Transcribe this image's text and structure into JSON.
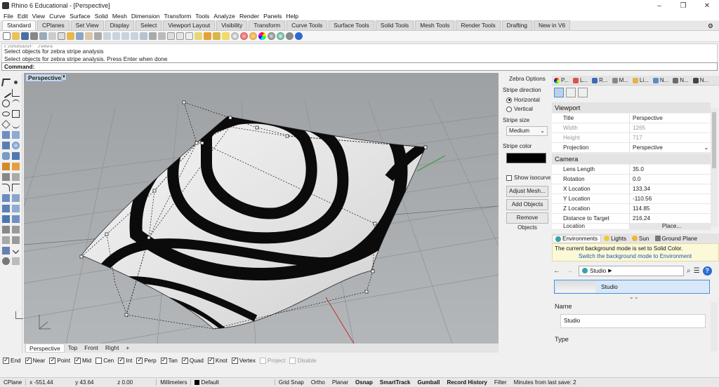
{
  "window": {
    "title": "Rhino 6 Educational - [Perspective]",
    "controls": [
      "–",
      "❐",
      "✕"
    ]
  },
  "menu": [
    "File",
    "Edit",
    "View",
    "Curve",
    "Surface",
    "Solid",
    "Mesh",
    "Dimension",
    "Transform",
    "Tools",
    "Analyze",
    "Render",
    "Panels",
    "Help"
  ],
  "toolbar_tabs": [
    "Standard",
    "CPlanes",
    "Set View",
    "Display",
    "Select",
    "Viewport Layout",
    "Visibility",
    "Transform",
    "Curve Tools",
    "Surface Tools",
    "Solid Tools",
    "Mesh Tools",
    "Render Tools",
    "Drafting",
    "New in V6"
  ],
  "toolbar_tabs_active": "Standard",
  "command_history": [
    "Command: _Zebra",
    "Select objects for zebra stripe analysis",
    "Select objects for zebra stripe analysis. Press Enter when done"
  ],
  "command_prompt": "Command:",
  "viewport": {
    "name": "Perspective",
    "tabs": [
      "Perspective",
      "Top",
      "Front",
      "Right"
    ],
    "add_tab": "+"
  },
  "zebra": {
    "title": "Zebra Options",
    "direction_label": "Stripe direction",
    "direction_options": [
      "Horizontal",
      "Vertical"
    ],
    "direction_selected": "Horizontal",
    "size_label": "Stripe size",
    "size_value": "Medium",
    "color_label": "Stripe color",
    "stripe_color": "#000000",
    "show_isocurves": "Show isocurves",
    "buttons": [
      "Adjust Mesh...",
      "Add Objects",
      "Remove Objects"
    ]
  },
  "properties": {
    "tabs": [
      "P...",
      "L...",
      "R...",
      "M...",
      "Li...",
      "N...",
      "N...",
      "N..."
    ],
    "sections": {
      "viewport": "Viewport",
      "camera": "Camera"
    },
    "viewport_rows": [
      {
        "key": "Title",
        "value": "Perspective",
        "dim": false
      },
      {
        "key": "Width",
        "value": "1265",
        "dim": true
      },
      {
        "key": "Height",
        "value": "717",
        "dim": true
      },
      {
        "key": "Projection",
        "value": "Perspective",
        "dim": false
      }
    ],
    "camera_rows": [
      {
        "key": "Lens Length",
        "value": "35.0"
      },
      {
        "key": "Rotation",
        "value": "0.0"
      },
      {
        "key": "X Location",
        "value": "133.34"
      },
      {
        "key": "Y Location",
        "value": "-110.56"
      },
      {
        "key": "Z Location",
        "value": "114.85"
      },
      {
        "key": "Distance to Target",
        "value": "216.24"
      },
      {
        "key": "Location",
        "value": "Place..."
      }
    ]
  },
  "environments": {
    "tabs": [
      "Environments",
      "Lights",
      "Sun",
      "Ground Plane"
    ],
    "note": "The current background mode is set to Solid Color.",
    "note_link": "Switch the background mode to Environment",
    "crumb": "Studio",
    "thumb_name": "Studio",
    "name_label": "Name",
    "name_value": "Studio",
    "type_label": "Type"
  },
  "osnaps": [
    {
      "label": "End",
      "on": true
    },
    {
      "label": "Near",
      "on": true
    },
    {
      "label": "Point",
      "on": true
    },
    {
      "label": "Mid",
      "on": true
    },
    {
      "label": "Cen",
      "on": false
    },
    {
      "label": "Int",
      "on": true
    },
    {
      "label": "Perp",
      "on": true
    },
    {
      "label": "Tan",
      "on": true
    },
    {
      "label": "Quad",
      "on": true
    },
    {
      "label": "Knot",
      "on": true
    },
    {
      "label": "Vertex",
      "on": true
    },
    {
      "label": "Project",
      "on": false,
      "disabled": true
    },
    {
      "label": "Disable",
      "on": false,
      "disabled": true
    }
  ],
  "status": {
    "cplane": "CPlane",
    "x": "x -551.44",
    "y": "y 43.64",
    "z": "z 0.00",
    "units": "Millimeters",
    "layer": "Default",
    "toggles": [
      "Grid Snap",
      "Ortho",
      "Planar",
      "Osnap",
      "SmartTrack",
      "Gumball",
      "Record History",
      "Filter"
    ],
    "bold_toggles": [
      "Osnap",
      "SmartTrack",
      "Gumball",
      "Record History"
    ],
    "autosave": "Minutes from last save: 2"
  }
}
